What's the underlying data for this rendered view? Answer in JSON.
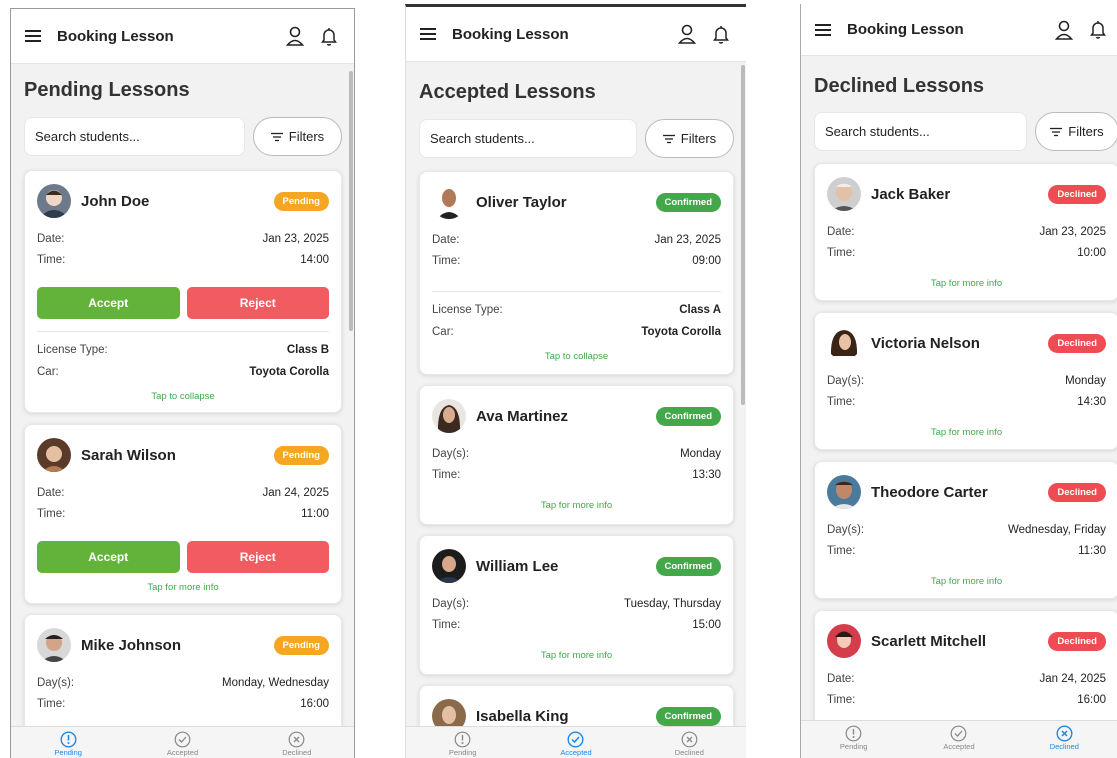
{
  "app": {
    "title": "Booking Lesson"
  },
  "search": {
    "placeholder": "Search students..."
  },
  "filters_label": "Filters",
  "nav": {
    "pending": "Pending",
    "accepted": "Accepted",
    "declined": "Declined"
  },
  "labels": {
    "date": "Date:",
    "time": "Time:",
    "days": "Day(s):",
    "license": "License Type:",
    "car": "Car:",
    "accept": "Accept",
    "reject": "Reject",
    "tap_more": "Tap for more info",
    "tap_collapse": "Tap to collapse"
  },
  "colors": {
    "pending": "#f5a623",
    "confirmed": "#43a84a",
    "declined": "#ef4b52",
    "accept": "#63b33a",
    "reject": "#f25b5f",
    "active_nav": "#1e88e5"
  },
  "pending": {
    "title": "Pending Lessons",
    "badge": "Pending",
    "cards": [
      {
        "name": "John Doe",
        "date": "Jan 23, 2025",
        "time": "14:00",
        "license": "Class B",
        "car": "Toyota Corolla"
      },
      {
        "name": "Sarah Wilson",
        "date": "Jan 24, 2025",
        "time": "11:00"
      },
      {
        "name": "Mike Johnson",
        "days": "Monday, Wednesday",
        "time": "16:00"
      }
    ]
  },
  "accepted": {
    "title": "Accepted Lessons",
    "badge": "Confirmed",
    "cards": [
      {
        "name": "Oliver Taylor",
        "date": "Jan 23, 2025",
        "time": "09:00",
        "license": "Class A",
        "car": "Toyota Corolla"
      },
      {
        "name": "Ava Martinez",
        "days": "Monday",
        "time": "13:30"
      },
      {
        "name": "William Lee",
        "days": "Tuesday, Thursday",
        "time": "15:00"
      },
      {
        "name": "Isabella King"
      }
    ]
  },
  "declined": {
    "title": "Declined Lessons",
    "badge": "Declined",
    "cards": [
      {
        "name": "Jack Baker",
        "date": "Jan 23, 2025",
        "time": "10:00"
      },
      {
        "name": "Victoria Nelson",
        "days": "Monday",
        "time": "14:30"
      },
      {
        "name": "Theodore Carter",
        "days": "Wednesday, Friday",
        "time": "11:30"
      },
      {
        "name": "Scarlett Mitchell",
        "date": "Jan 24, 2025",
        "time": "16:00"
      }
    ]
  }
}
